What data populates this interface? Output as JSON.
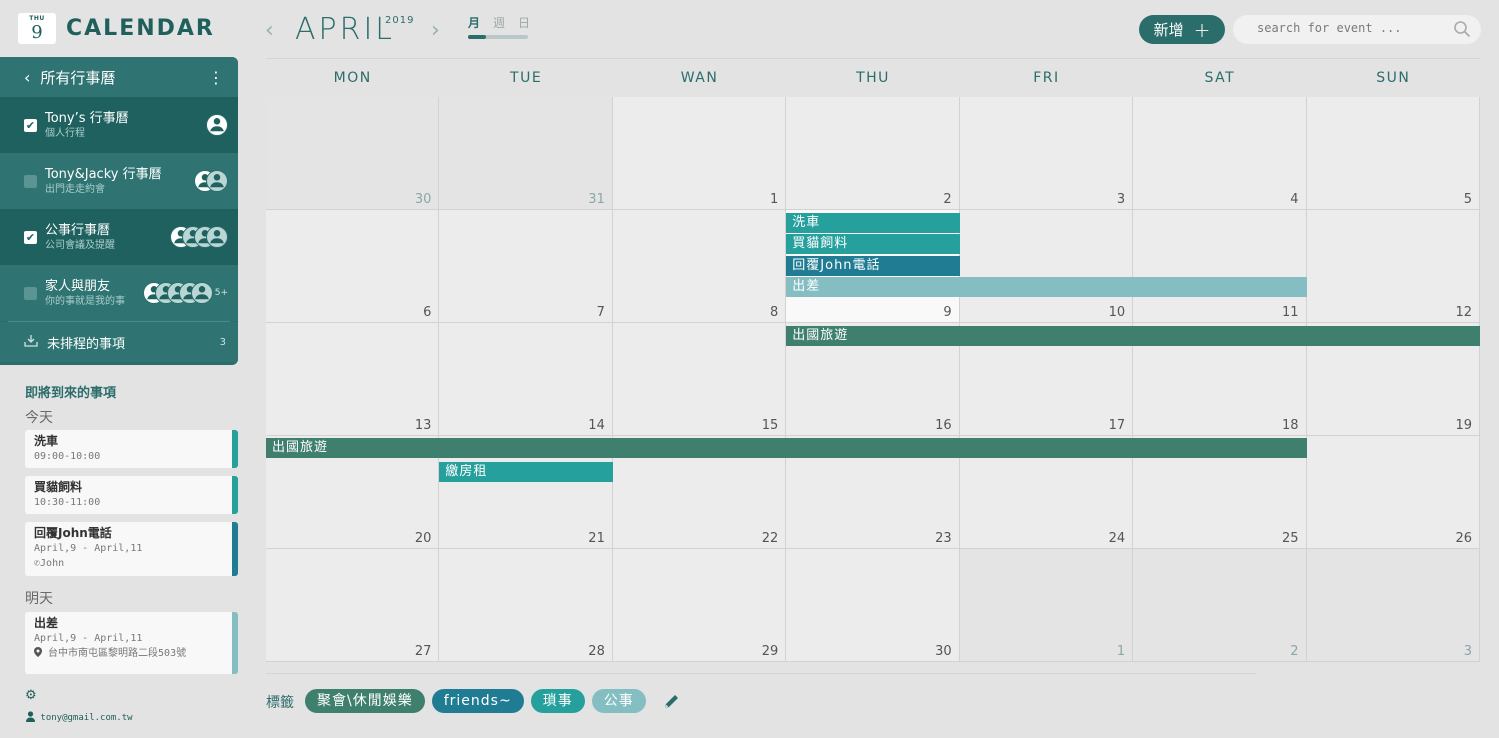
{
  "logo": {
    "dow": "THU",
    "day": "9",
    "title": "CALENDAR"
  },
  "sidebar": {
    "header": "所有行事曆",
    "calendars": [
      {
        "name": "Tony’s 行事曆",
        "sub": "個人行程",
        "checked": true
      },
      {
        "name": "Tony&Jacky 行事曆",
        "sub": "出門走走約會",
        "checked": false
      },
      {
        "name": "公事行事曆",
        "sub": "公司會議及提醒",
        "checked": true
      },
      {
        "name": "家人與朋友",
        "sub": "你的事就是我的事",
        "checked": false,
        "more": "5+"
      }
    ],
    "unscheduled": {
      "label": "未排程的事項",
      "count": "3"
    }
  },
  "upcoming": {
    "title": "即將到來的事項",
    "today_label": "今天",
    "tomorrow_label": "明天",
    "today": [
      {
        "title": "洗車",
        "time": "09:00-10:00",
        "color": "#26a09c"
      },
      {
        "title": "買貓飼料",
        "time": "10:30-11:00",
        "color": "#26a09c"
      },
      {
        "title": "回覆John電話",
        "time": "April,9 - April,11",
        "contact": "John",
        "color": "#1f7c93"
      }
    ],
    "tomorrow": [
      {
        "title": "出差",
        "time": "April,9 - April,11",
        "location": "台中市南屯區黎明路二段503號",
        "color": "#84bec3"
      }
    ]
  },
  "footer": {
    "email": "tony@gmail.com.tw"
  },
  "topbar": {
    "month": "APRIL",
    "year": "2019",
    "views": [
      "月",
      "週",
      "日"
    ],
    "active_view": "月",
    "add_label": "新增",
    "search_placeholder": "search for event ..."
  },
  "calendar": {
    "weekdays": [
      "MON",
      "TUE",
      "WAN",
      "THU",
      "FRI",
      "SAT",
      "SUN"
    ],
    "weeks": [
      [
        30,
        31,
        1,
        2,
        3,
        4,
        5
      ],
      [
        6,
        7,
        8,
        9,
        10,
        11,
        12
      ],
      [
        13,
        14,
        15,
        16,
        17,
        18,
        19
      ],
      [
        20,
        21,
        22,
        23,
        24,
        25,
        26
      ],
      [
        27,
        28,
        29,
        30,
        1,
        2,
        3
      ]
    ],
    "today": {
      "week": 1,
      "day": 3
    },
    "events": [
      {
        "title": "洗車",
        "week": 1,
        "start": 3,
        "span": 1,
        "row": 0,
        "color": "#26a09c"
      },
      {
        "title": "買貓飼料",
        "week": 1,
        "start": 3,
        "span": 1,
        "row": 1,
        "color": "#26a09c"
      },
      {
        "title": "回覆John電話",
        "week": 1,
        "start": 3,
        "span": 1,
        "row": 2,
        "color": "#1f7c93"
      },
      {
        "title": "出差",
        "week": 1,
        "start": 3,
        "span": 3,
        "row": 3,
        "color": "#84bec3"
      },
      {
        "title": "出國旅遊",
        "week": 2,
        "start": 3,
        "span": 4,
        "row": 0,
        "color": "#3f7f6d"
      },
      {
        "title": "出國旅遊",
        "week": 3,
        "start": 0,
        "span": 6,
        "row": 0,
        "color": "#3f7f6d"
      },
      {
        "title": "繳房租",
        "week": 3,
        "start": 1,
        "span": 1,
        "row": 1,
        "color": "#26a09c"
      }
    ]
  },
  "tags": {
    "label": "標籤",
    "items": [
      {
        "name": "聚會\\休閒娛樂",
        "color": "#3f7f6d"
      },
      {
        "name": "friends~",
        "color": "#1f7c93"
      },
      {
        "name": "瑣事",
        "color": "#26a09c"
      },
      {
        "name": "公事",
        "color": "#84bec3"
      }
    ]
  }
}
